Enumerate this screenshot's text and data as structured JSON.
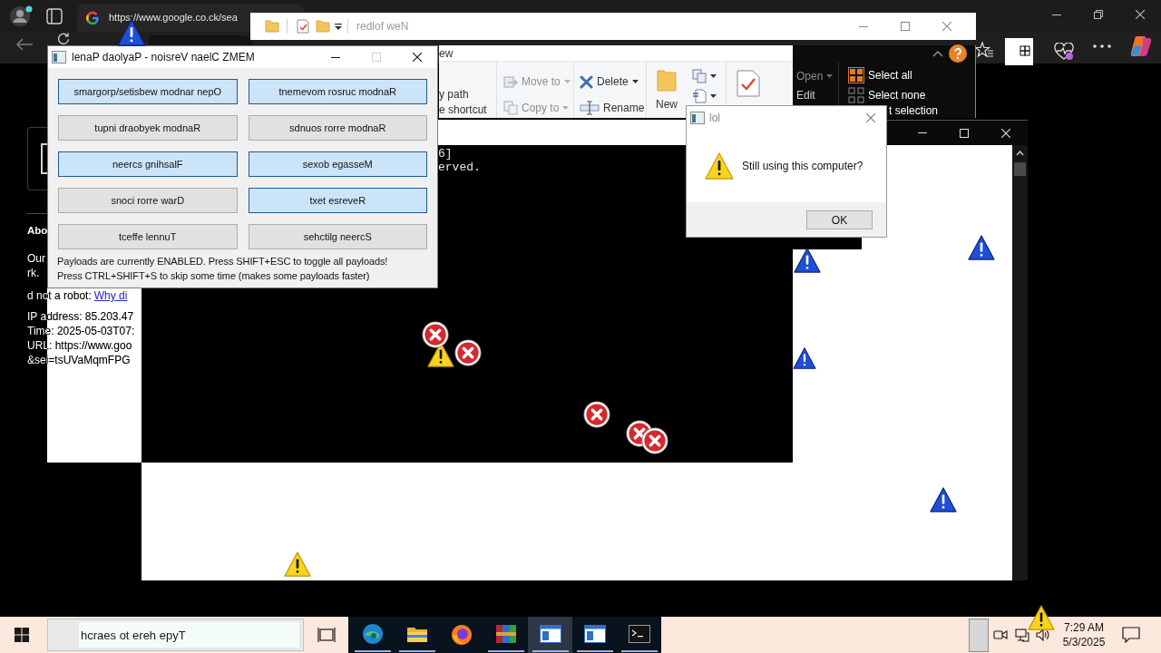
{
  "browser": {
    "tab_title": "https://www.google.co.ck/sea",
    "page": {
      "heading": "Abo",
      "lines": [
        "Our",
        "rk."
      ],
      "robot_check": {
        "text": "d not a robot:",
        "link": "Why di"
      },
      "details": [
        "IP address: 85.203.47",
        "Time: 2025-05-03T07:",
        "URL: https://www.goo",
        "&sei=tsUVaMqmFPG"
      ]
    }
  },
  "explorer": {
    "title": "redlof weN",
    "ribbon": {
      "tab": "ew",
      "clipboard": [
        "y path",
        "e shortcut"
      ],
      "organize": [
        {
          "items": [
            {
              "kind": "move",
              "label": "Move to",
              "dropdown": true,
              "disabled": true
            },
            {
              "kind": "copy",
              "label": "Copy to",
              "dropdown": true,
              "disabled": true
            }
          ]
        },
        {
          "items": [
            {
              "kind": "delete",
              "label": "Delete",
              "dropdown": true,
              "disabled": false
            },
            {
              "kind": "rename",
              "label": "Rename",
              "dropdown": false,
              "disabled": false
            }
          ]
        }
      ],
      "new_label": "New",
      "open": [
        {
          "label": "Open",
          "dropdown": true,
          "disabled": true
        },
        {
          "label": "Edit",
          "dropdown": false,
          "disabled": false
        }
      ],
      "select": [
        {
          "kind": "select-all",
          "label": "Select all"
        },
        {
          "kind": "select-none",
          "label": "Select none"
        },
        {
          "kind": "invert",
          "label": "t selection"
        }
      ]
    }
  },
  "console": {
    "lines": [
      "6]",
      "erved."
    ]
  },
  "payload_panel": {
    "title": "lenaP daolyaP - noisreV naelC ZMEM",
    "maximize_disabled": true,
    "buttons": [
      {
        "label": "smargorp/setisbew modnar nepO",
        "on": true
      },
      {
        "label": "tnemevom rosruc modnaR",
        "on": true
      },
      {
        "label": "tupni draobyek modnaR",
        "on": false
      },
      {
        "label": "sdnuos rorre modnaR",
        "on": false
      },
      {
        "label": "neercs gnihsalF",
        "on": true
      },
      {
        "label": "sexob egasseM",
        "on": true
      },
      {
        "label": "snoci rorre warD",
        "on": false
      },
      {
        "label": "txet esreveR",
        "on": true
      },
      {
        "label": "tceffe lennuT",
        "on": false
      },
      {
        "label": "sehctilg neercS",
        "on": false
      }
    ],
    "status_lines": [
      "Payloads are currently ENABLED. Press SHIFT+ESC to toggle all payloads!",
      "Press CTRL+SHIFT+S to skip some time (makes some payloads faster)"
    ]
  },
  "dialog": {
    "title": "lol",
    "message": "Still using this computer?",
    "buttons": [
      "OK"
    ]
  },
  "taskbar": {
    "search": {
      "placeholder": "hcraes ot ereh epyT"
    },
    "apps": [
      {
        "kind": "edge",
        "running": true,
        "active": false
      },
      {
        "kind": "explorer",
        "running": true,
        "active": false
      },
      {
        "kind": "firefox",
        "running": false,
        "active": false
      },
      {
        "kind": "winrar",
        "running": true,
        "active": false
      },
      {
        "kind": "app-window",
        "running": true,
        "active": true
      },
      {
        "kind": "app-window",
        "running": true,
        "active": false
      },
      {
        "kind": "console",
        "running": true,
        "active": false
      }
    ],
    "clock": {
      "time": "7:29 AM",
      "date": "5/3/2025"
    }
  }
}
